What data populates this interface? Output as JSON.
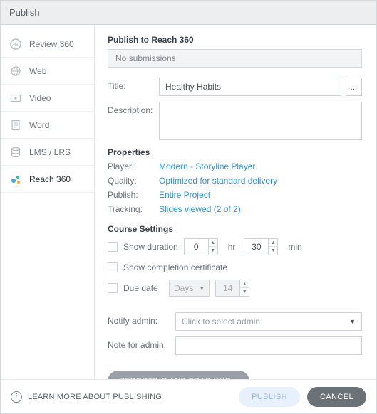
{
  "window": {
    "title": "Publish"
  },
  "sidebar": {
    "items": [
      {
        "label": "Review 360"
      },
      {
        "label": "Web"
      },
      {
        "label": "Video"
      },
      {
        "label": "Word"
      },
      {
        "label": "LMS / LRS"
      },
      {
        "label": "Reach 360"
      }
    ]
  },
  "main": {
    "heading": "Publish to Reach 360",
    "no_submissions": "No submissions",
    "title_label": "Title:",
    "title_value": "Healthy Habits",
    "ellipsis": "...",
    "description_label": "Description:",
    "description_value": ""
  },
  "properties": {
    "heading": "Properties",
    "player_label": "Player:",
    "player_value": "Modern - Storyline Player",
    "quality_label": "Quality:",
    "quality_value": "Optimized for standard delivery",
    "publish_label": "Publish:",
    "publish_value": "Entire Project",
    "tracking_label": "Tracking:",
    "tracking_value": "Slides viewed (2 of 2)"
  },
  "course": {
    "heading": "Course Settings",
    "show_duration_label": "Show duration",
    "duration_hr": "0",
    "hr_unit": "hr",
    "duration_min": "30",
    "min_unit": "min",
    "show_cert_label": "Show completion certificate",
    "due_date_label": "Due date",
    "due_unit": "Days",
    "due_value": "14",
    "notify_label": "Notify admin:",
    "notify_placeholder": "Click to select admin",
    "note_label": "Note for admin:",
    "note_value": "",
    "reporting_btn": "REPORTING AND TRACKING..."
  },
  "footer": {
    "learn": "LEARN MORE ABOUT PUBLISHING",
    "publish": "PUBLISH",
    "cancel": "CANCEL"
  }
}
